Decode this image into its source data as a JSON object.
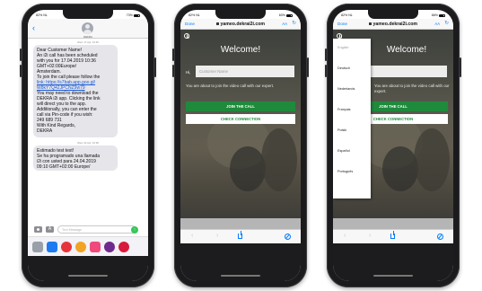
{
  "colors": {
    "imessage_bubble": "#e5e5ea",
    "link": "#1a5ad4",
    "ios_blue": "#007aff",
    "dekra_green": "#1f8a3c",
    "send_green": "#34c759"
  },
  "phone1": {
    "status": {
      "carrier": "82% NL",
      "time": "11:44",
      "battery": "73%"
    },
    "header": {
      "back_icon": "chevron-left-icon",
      "contact": "DEKRA"
    },
    "messages": [
      {
        "time": "Wed, 17 Apr, 10:36",
        "lines": [
          "Dear Customer Name!",
          "An i2i call has been scheduled",
          "with you for 17.04.2019 10:36",
          "GMT+02:00Europe/",
          "Amsterdam.",
          "To join the call please follow the",
          "link: https://s7bab.app.goo.gl/",
          "W8kY7Q42JPCNZ9w79",
          "You may need to download the",
          "DEKRA i2i app. Clicking the link",
          "will direct you to the app.",
          "Additionally, you can enter the",
          "call via Pin-code if you wish:",
          "249 689 731",
          "With Kind Regards,",
          "DEKRA"
        ]
      },
      {
        "time": "Wed, 24 Apr, 10:38",
        "lines": [
          "Estimado test test!",
          "Se ha programado una llamada",
          "i2i con usted para 24.04.2019",
          "09:10 GMT+02:00 Europe/"
        ]
      }
    ],
    "input_placeholder": "Text Message",
    "camera_icon": "camera-icon",
    "apps_icon": "app-store-icon",
    "send_icon": "arrow-up-icon"
  },
  "browser": {
    "done": "Done",
    "url": "yameo.dekrai2i.com",
    "aa": "AA",
    "reload_icon": "reload-icon",
    "status2": {
      "carrier": "82% NL",
      "time": "11:28",
      "battery": "60%"
    },
    "status3": {
      "carrier": "82% NL",
      "time": "11:31",
      "battery": "66%"
    }
  },
  "webpage": {
    "welcome": "Welcome!",
    "hi": "Hi,",
    "name_placeholder": "Customer Name",
    "about": "You are about to join the video call with our expert.",
    "join_button": "JOIN THE CALL",
    "check_button": "CHECK CONNECTION"
  },
  "languages": [
    "English",
    "Deutsch",
    "Nederlands",
    "Français",
    "Polski",
    "Español",
    "Português"
  ]
}
